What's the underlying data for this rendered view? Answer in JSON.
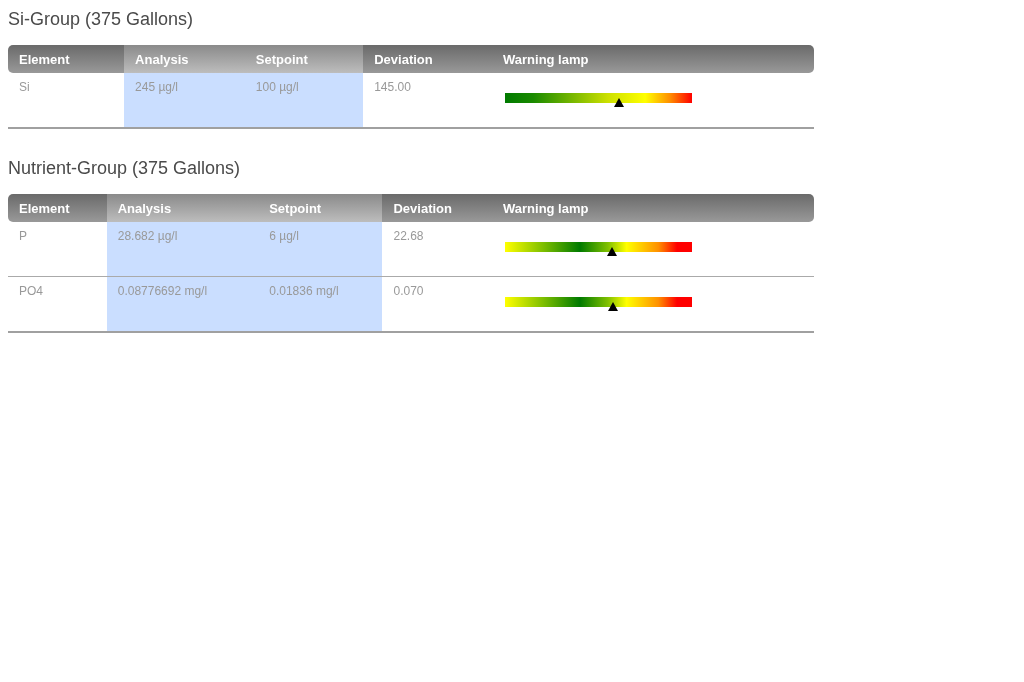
{
  "groups": [
    {
      "title": "Si-Group (375 Gallons)",
      "columns": [
        {
          "label": "Element",
          "highlighted": false
        },
        {
          "label": "Analysis",
          "highlighted": true
        },
        {
          "label": "Setpoint",
          "highlighted": true
        },
        {
          "label": "Deviation",
          "highlighted": false
        },
        {
          "label": "Warning lamp",
          "highlighted": false
        }
      ],
      "rows": [
        {
          "element": "Si",
          "analysis": "245 µg/l",
          "setpoint": "100 µg/l",
          "deviation": "145.00",
          "lamp": {
            "kind": "one-sided",
            "level": 0.61
          }
        }
      ]
    },
    {
      "title": "Nutrient-Group (375 Gallons)",
      "columns": [
        {
          "label": "Element",
          "highlighted": false
        },
        {
          "label": "Analysis",
          "highlighted": true
        },
        {
          "label": "Setpoint",
          "highlighted": true
        },
        {
          "label": "Deviation",
          "highlighted": false
        },
        {
          "label": "Warning lamp",
          "highlighted": false
        }
      ],
      "rows": [
        {
          "element": "P",
          "analysis": "28.682 µg/l",
          "setpoint": "6 µg/l",
          "deviation": "22.68",
          "lamp": {
            "kind": "two-sided",
            "level": 0.57
          }
        },
        {
          "element": "PO4",
          "analysis": "0.08776692 mg/l",
          "setpoint": "0.01836 mg/l",
          "deviation": "0.070",
          "lamp": {
            "kind": "two-sided",
            "level": 0.58
          }
        }
      ]
    }
  ]
}
